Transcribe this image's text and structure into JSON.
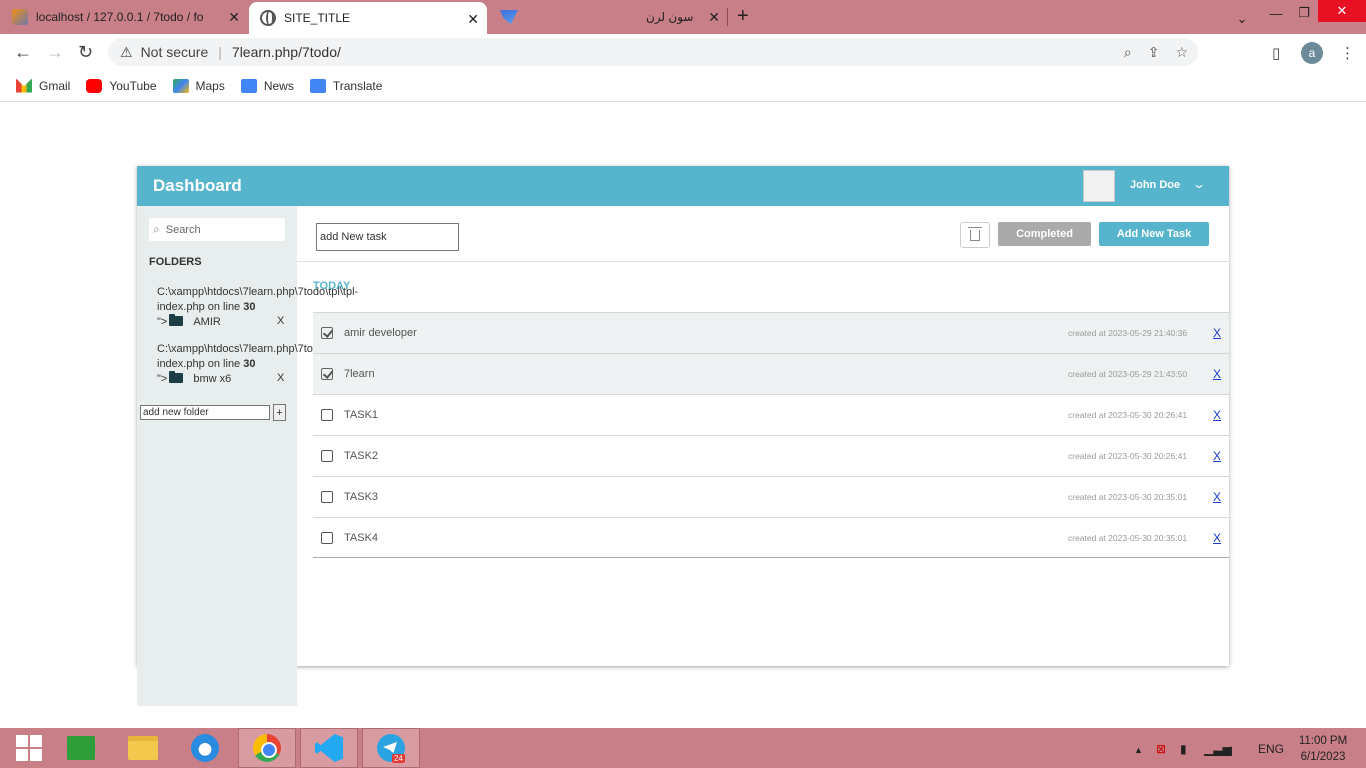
{
  "browser": {
    "tabs": [
      {
        "title": "localhost / 127.0.0.1 / 7todo / fo",
        "icon": "phpmyadmin-icon"
      },
      {
        "title": "SITE_TITLE",
        "icon": "globe-icon"
      },
      {
        "title": "سون لرن",
        "icon": "sevenlearn-icon"
      }
    ],
    "address": {
      "security": "Not secure",
      "url": "7learn.php/7todo/"
    },
    "profile_initial": "a",
    "bookmarks": [
      "Gmail",
      "YouTube",
      "Maps",
      "News",
      "Translate"
    ]
  },
  "app": {
    "title": "Dashboard",
    "user_name": "John Doe",
    "search_placeholder": "Search",
    "folders_label": "FOLDERS",
    "folders": [
      {
        "path1": "C:\\xampp\\htdocs\\7learn.php\\7todo\\tpl\\tpl-",
        "path2": "index.php on line ",
        "line": "30",
        "prefix": "\">",
        "name": "AMIR",
        "delete": "X"
      },
      {
        "path1": "C:\\xampp\\htdocs\\7learn.php\\7todo\\tpl\\tpl-",
        "path2": "index.php on line ",
        "line": "30",
        "prefix": "\">",
        "name": "bmw x6",
        "delete": "X"
      }
    ],
    "new_folder_placeholder": "add new folder",
    "new_folder_button": "+",
    "new_task_placeholder": "add New task",
    "completed_button": "Completed",
    "add_task_button": "Add New Task",
    "section_label": "TODAY",
    "tasks": [
      {
        "title": "amir developer",
        "created": "created at 2023-05-29 21:40:36",
        "done": true,
        "delete": "X"
      },
      {
        "title": "7learn",
        "created": "created at 2023-05-29 21:43:50",
        "done": true,
        "delete": "X"
      },
      {
        "title": "TASK1",
        "created": "created at 2023-05-30 20:26:41",
        "done": false,
        "delete": "X"
      },
      {
        "title": "TASK2",
        "created": "created at 2023-05-30 20:26:41",
        "done": false,
        "delete": "X"
      },
      {
        "title": "TASK3",
        "created": "created at 2023-05-30 20:35:01",
        "done": false,
        "delete": "X"
      },
      {
        "title": "TASK4",
        "created": "created at 2023-05-30 20:35:01",
        "done": false,
        "delete": "X"
      }
    ]
  },
  "taskbar": {
    "apps": [
      "windows-start",
      "store",
      "file-explorer",
      "internet-explorer",
      "chrome",
      "vscode",
      "telegram"
    ],
    "telegram_badge": "24",
    "language": "ENG",
    "time": "11:00 PM",
    "date": "6/1/2023"
  },
  "colors": {
    "accent": "#56b5cc",
    "chrome_frame": "#c87f88",
    "completed_gray": "#aaaaaa",
    "link_blue": "#1a3cd4"
  }
}
